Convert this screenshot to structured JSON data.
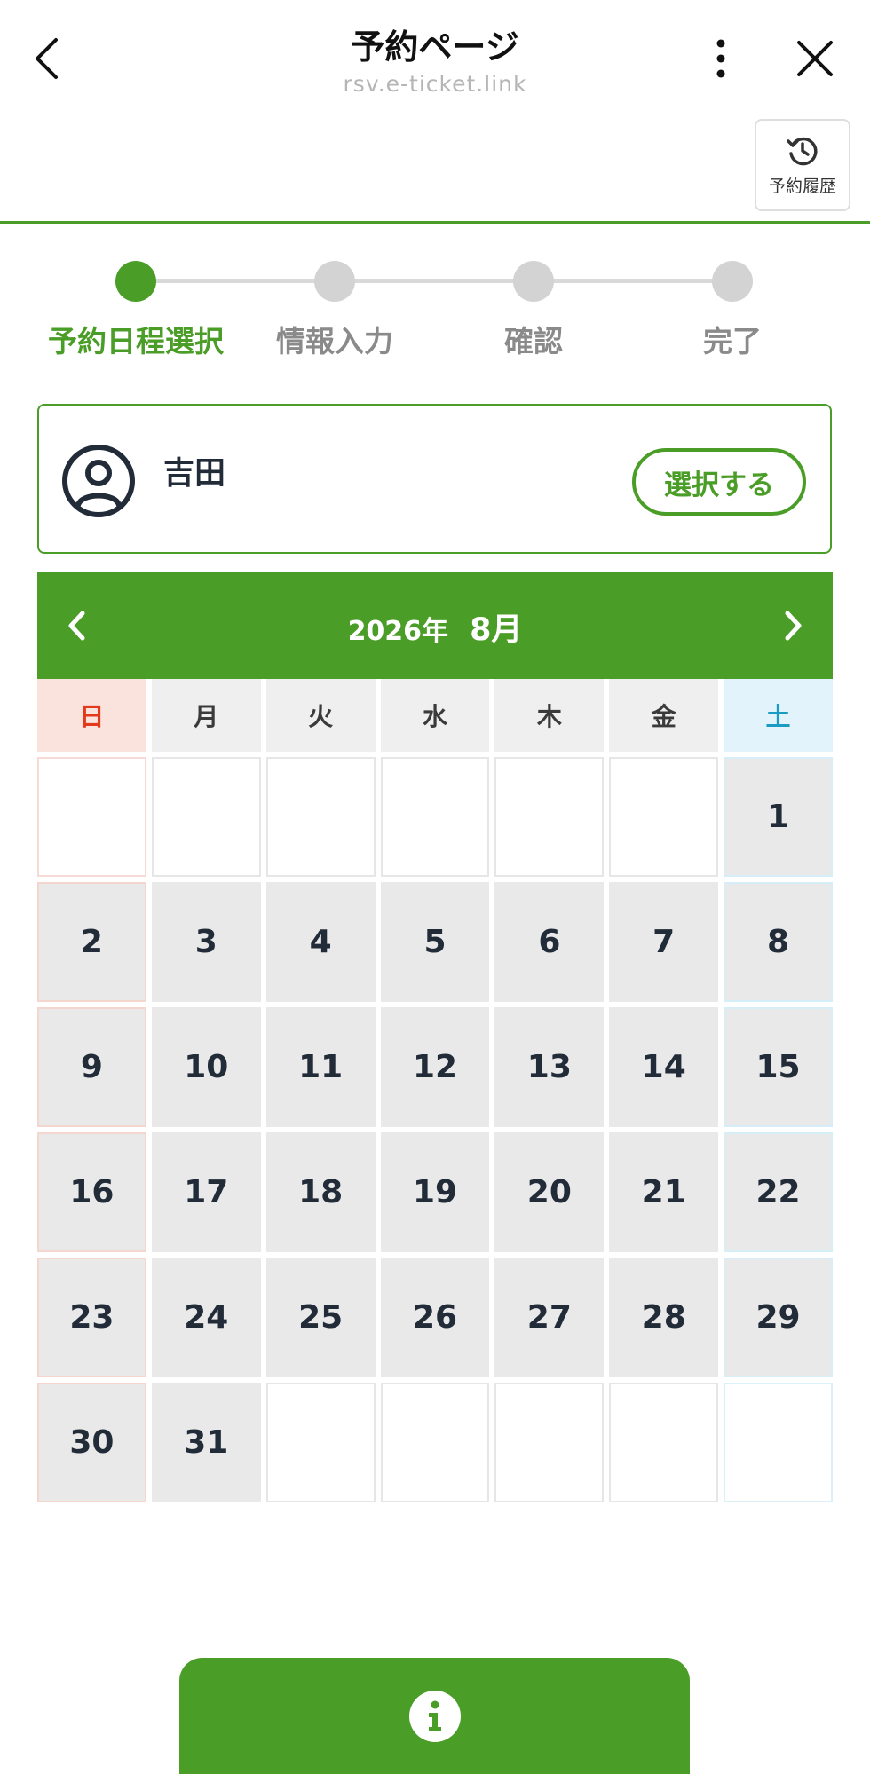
{
  "header": {
    "title": "予約ページ",
    "subtitle": "rsv.e-ticket.link",
    "history_label": "予約履歴"
  },
  "steps": [
    {
      "label": "予約日程選択",
      "active": true
    },
    {
      "label": "情報入力",
      "active": false
    },
    {
      "label": "確認",
      "active": false
    },
    {
      "label": "完了",
      "active": false
    }
  ],
  "person": {
    "name": "吉田",
    "select_label": "選択する"
  },
  "calendar": {
    "year_label": "2026年",
    "month_label": "8月",
    "weekdays": [
      "日",
      "月",
      "火",
      "水",
      "木",
      "金",
      "土"
    ],
    "days": [
      "",
      "",
      "",
      "",
      "",
      "",
      "1",
      "2",
      "3",
      "4",
      "5",
      "6",
      "7",
      "8",
      "9",
      "10",
      "11",
      "12",
      "13",
      "14",
      "15",
      "16",
      "17",
      "18",
      "19",
      "20",
      "21",
      "22",
      "23",
      "24",
      "25",
      "26",
      "27",
      "28",
      "29",
      "30",
      "31",
      "",
      "",
      "",
      "",
      ""
    ]
  },
  "colors": {
    "accent": "#4a9d26",
    "sunday": "#e23a1b",
    "saturday": "#1a9bc2"
  },
  "icons": {
    "back": "chevron-left-icon",
    "more": "more-vertical-icon",
    "close": "close-icon",
    "history": "history-icon",
    "avatar": "user-circle-icon",
    "info": "info-icon"
  }
}
